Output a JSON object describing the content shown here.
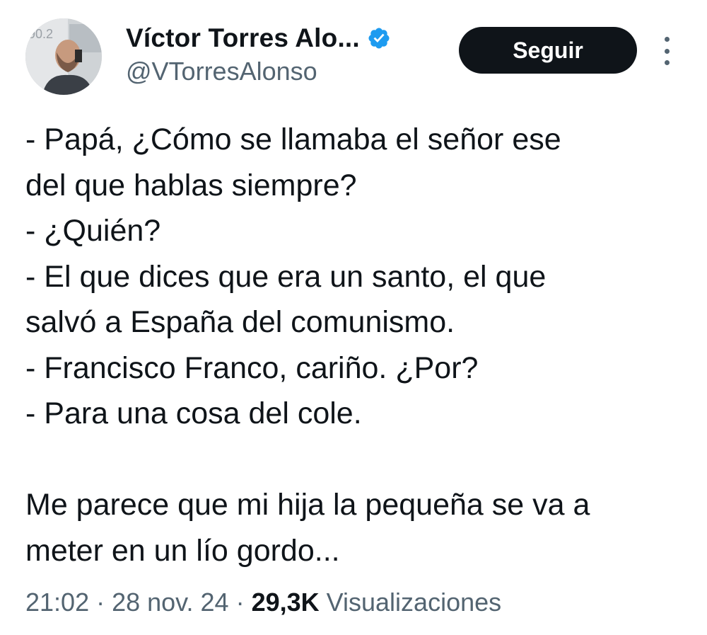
{
  "author": {
    "display_name": "Víctor Torres Alo...",
    "handle": "@VTorresAlonso",
    "verified": true,
    "avatar_icon": "profile-photo"
  },
  "actions": {
    "follow_label": "Seguir",
    "more_icon": "more-vertical-icon"
  },
  "tweet": {
    "lines": [
      "- Papá, ¿Cómo se llamaba el señor ese",
      "del que hablas siempre?",
      "- ¿Quién?",
      "- El que dices que era un santo, el que",
      "salvó a España del comunismo.",
      "- Francisco Franco, cariño. ¿Por?",
      "- Para una cosa del cole."
    ],
    "closing_lines": [
      "Me parece que mi hija la pequeña se va a",
      "meter en un lío gordo..."
    ]
  },
  "meta": {
    "time": "21:02",
    "separator": " · ",
    "date": "28 nov. 24",
    "views_count": "29,3K",
    "views_label": "Visualizaciones"
  },
  "colors": {
    "text": "#0f1419",
    "secondary": "#536471",
    "verified_badge": "#1d9bf0",
    "button_bg": "#0f1419",
    "button_text": "#ffffff"
  }
}
